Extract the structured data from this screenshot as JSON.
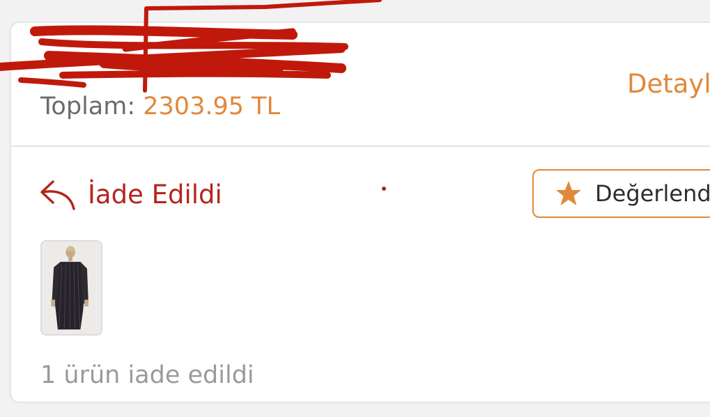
{
  "order": {
    "total_label": "Toplam:",
    "total_amount": "2303.95 TL",
    "details_link": "Detayl"
  },
  "status": {
    "label": "İade Edildi",
    "icon": "return-arrow-icon",
    "color": "#b3261e"
  },
  "actions": {
    "rate_label": "Değerlend",
    "rate_icon": "star-icon",
    "accent_color": "#e0883a"
  },
  "items": {
    "product_image": "product-thumbnail",
    "summary": "1 ürün iade edildi"
  }
}
